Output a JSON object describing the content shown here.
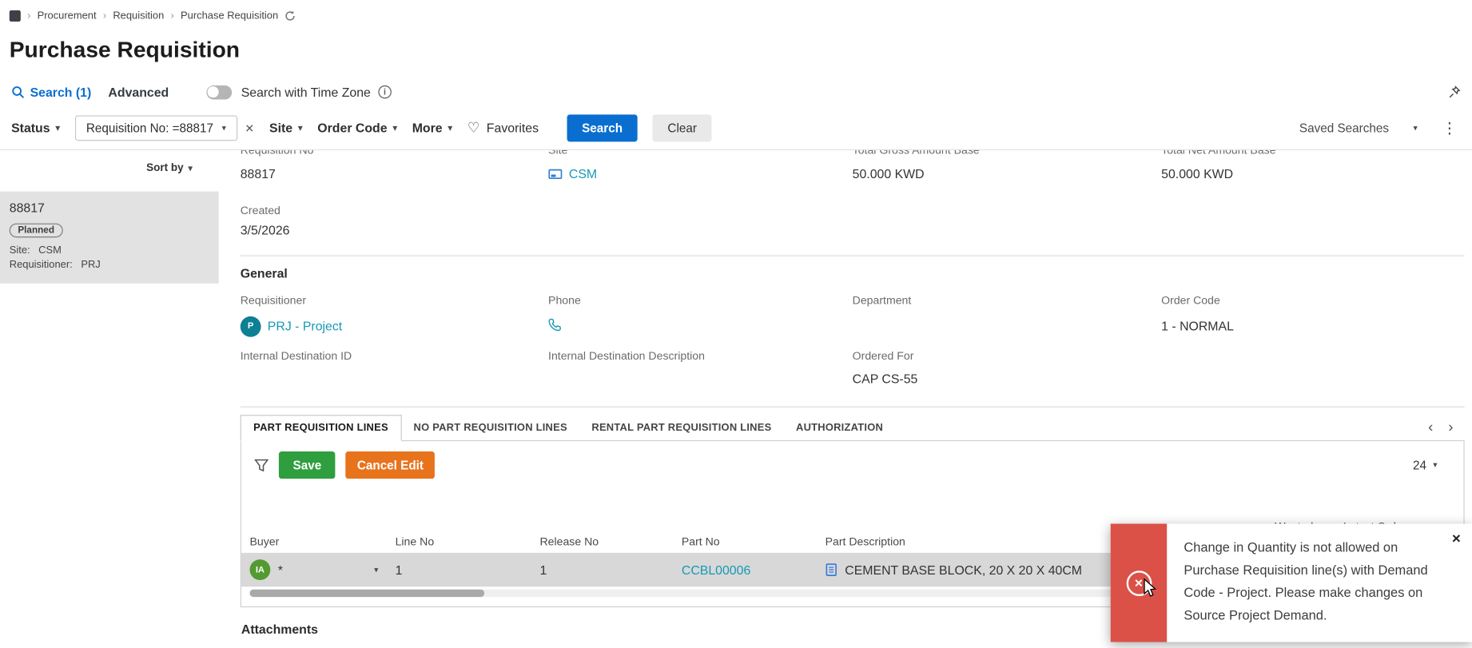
{
  "colors": {
    "accent_blue": "#0a6ed1",
    "link_teal": "#1699b4",
    "success_green": "#2e9e3e",
    "warning_orange": "#e8731d",
    "error_red": "#db5148",
    "edit_row_gray": "#d8d8d8"
  },
  "breadcrumb": {
    "items": [
      "Procurement",
      "Requisition",
      "Purchase Requisition"
    ]
  },
  "page": {
    "title": "Purchase Requisition"
  },
  "search_bar": {
    "search_label": "Search (1)",
    "advanced_label": "Advanced",
    "timezone_label": "Search with Time Zone"
  },
  "filter_bar": {
    "status": "Status",
    "chip": "Requisition No: =88817",
    "site": "Site",
    "order_code": "Order Code",
    "more": "More",
    "favorites": "Favorites",
    "search_button": "Search",
    "clear_button": "Clear",
    "saved_searches": "Saved Searches"
  },
  "sidebar": {
    "sort_by": "Sort by",
    "result": {
      "id": "88817",
      "status": "Planned",
      "site_label": "Site:",
      "site_value": "CSM",
      "requisitioner_label": "Requisitioner:",
      "requisitioner_value": "PRJ"
    }
  },
  "summary": {
    "requisition_no_label": "Requisition No",
    "requisition_no_value": "88817",
    "site_label": "Site",
    "site_value": "CSM",
    "gross_label": "Total Gross Amount Base",
    "gross_value": "50.000 KWD",
    "net_label": "Total Net Amount Base",
    "net_value": "50.000 KWD",
    "created_label": "Created",
    "created_value": "3/5/2026"
  },
  "general": {
    "title": "General",
    "requisitioner_label": "Requisitioner",
    "requisitioner_avatar": "P",
    "requisitioner_value": "PRJ - Project",
    "phone_label": "Phone",
    "department_label": "Department",
    "order_code_label": "Order Code",
    "order_code_value": "1 - NORMAL",
    "internal_destination_id_label": "Internal Destination ID",
    "internal_destination_description_label": "Internal Destination Description",
    "ordered_for_label": "Ordered For",
    "ordered_for_value": "CAP CS-55"
  },
  "tabs": [
    "PART REQUISITION LINES",
    "NO PART REQUISITION LINES",
    "RENTAL PART REQUISITION LINES",
    "AUTHORIZATION"
  ],
  "lines_tab": {
    "save_button": "Save",
    "cancel_edit_button": "Cancel Edit",
    "page_size": "24",
    "columns": [
      "Buyer",
      "Line No",
      "Release No",
      "Part No",
      "Part Description",
      "Wanted",
      "Latest Order"
    ],
    "row": {
      "buyer_avatar": "IA",
      "buyer_value": "*",
      "line_no": "1",
      "release_no": "1",
      "part_no": "CCBL00006",
      "part_description": "CEMENT BASE BLOCK, 20 X 20 X 40CM"
    }
  },
  "attachments": {
    "title": "Attachments"
  },
  "toast": {
    "message": "Change in Quantity is not allowed on Purchase Requisition line(s) with Demand Code - Project. Please make changes on Source Project Demand."
  }
}
